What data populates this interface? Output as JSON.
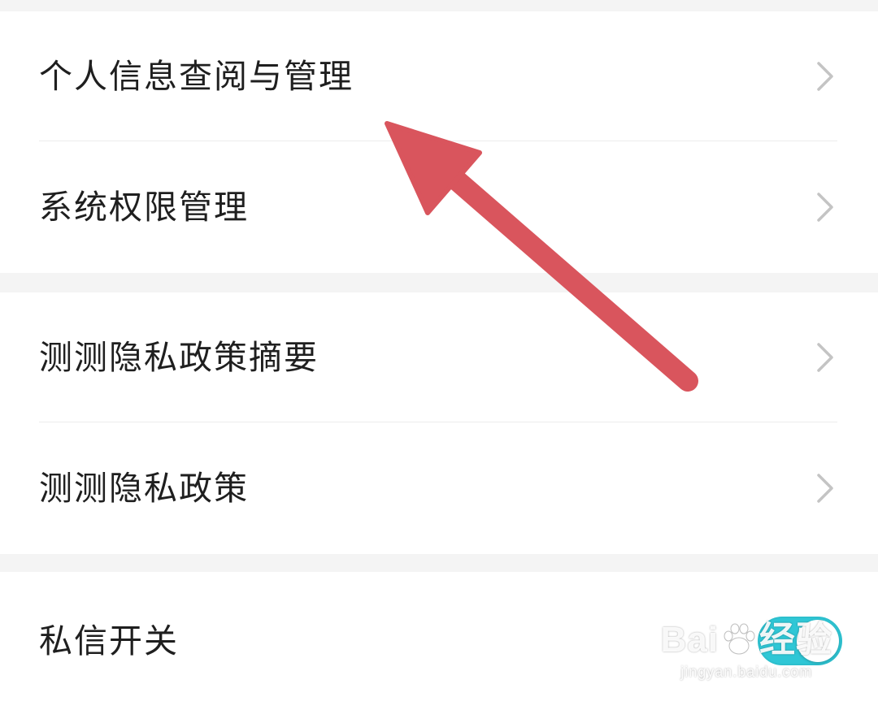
{
  "sections": [
    {
      "items": [
        {
          "label": "个人信息查阅与管理",
          "control": "chevron-right-icon"
        },
        {
          "label": "系统权限管理",
          "control": "chevron-right-icon"
        }
      ]
    },
    {
      "items": [
        {
          "label": "测测隐私政策摘要",
          "control": "chevron-right-icon"
        },
        {
          "label": "测测隐私政策",
          "control": "chevron-right-icon"
        }
      ]
    },
    {
      "items": [
        {
          "label": "私信开关",
          "control": "toggle",
          "toggle_on": true
        }
      ]
    }
  ],
  "annotation": {
    "arrow_color": "#d9555d",
    "points_to": "个人信息查阅与管理"
  },
  "watermark": {
    "brand_left": "Bai",
    "brand_right": "经验",
    "url": "jingyan.baidu.com"
  },
  "colors": {
    "background": "#f4f4f4",
    "card": "#ffffff",
    "text": "#1f1f1f",
    "chevron": "#c4c4c4",
    "toggle_on": "#2fc7d6"
  }
}
